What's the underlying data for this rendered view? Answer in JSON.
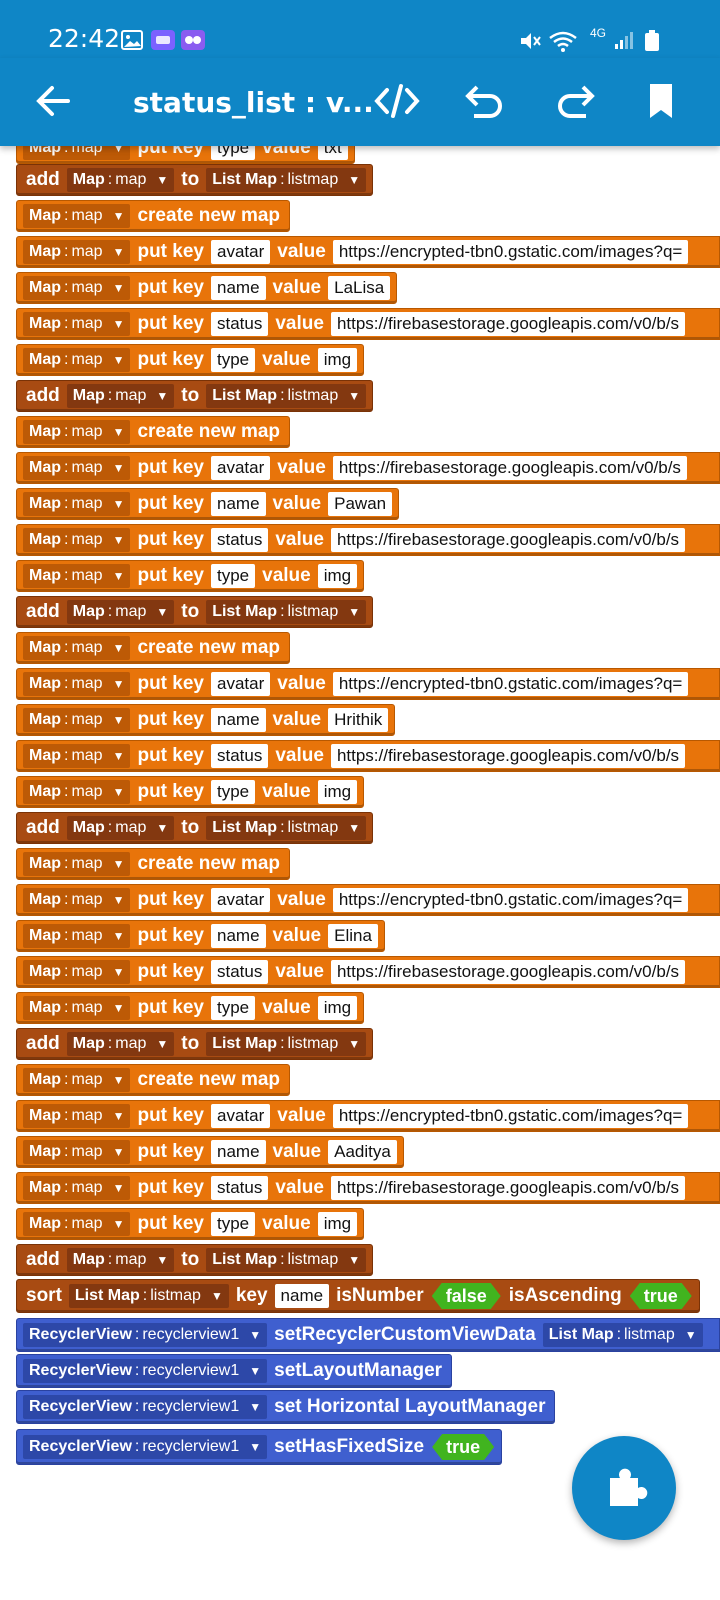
{
  "status_bar": {
    "time": "22:42",
    "network": "4G",
    "icons": [
      "gallery-icon",
      "purple-app-icon",
      "link-app-icon",
      "mute-icon",
      "wifi-icon",
      "signal-icon",
      "battery-icon"
    ]
  },
  "app_bar": {
    "title": "status_list : v...",
    "icons": [
      "back-arrow-icon",
      "code-icon",
      "undo-icon",
      "redo-icon",
      "bookmark-icon"
    ]
  },
  "labels": {
    "put_key": "put key",
    "value": "value",
    "create_new_map": "create new map",
    "add": "add",
    "to": "to",
    "map_type": "Map",
    "map_var": "map",
    "listmap_type": "List Map",
    "listmap_var": "listmap",
    "sort": "sort",
    "key": "key",
    "is_number": "isNumber",
    "is_ascending": "isAscending",
    "recycler_type": "RecyclerView",
    "recycler_var": "recyclerview1"
  },
  "blocks": {
    "partial_top": {
      "key": "type",
      "value": "txt"
    },
    "map_lalisa": {
      "avatar_key": "avatar",
      "avatar": "https://encrypted-tbn0.gstatic.com/images?q=",
      "name_key": "name",
      "name": "LaLisa",
      "status_key": "status",
      "status": "https://firebasestorage.googleapis.com/v0/b/s",
      "type_key": "type",
      "type": "img"
    },
    "map_pawan": {
      "avatar_key": "avatar",
      "avatar": "https://firebasestorage.googleapis.com/v0/b/s",
      "name_key": "name",
      "name": "Pawan",
      "status_key": "status",
      "status": "https://firebasestorage.googleapis.com/v0/b/s",
      "type_key": "type",
      "type": "img"
    },
    "map_hrithik": {
      "avatar_key": "avatar",
      "avatar": "https://encrypted-tbn0.gstatic.com/images?q=",
      "name_key": "name",
      "name": "Hrithik",
      "status_key": "status",
      "status": "https://firebasestorage.googleapis.com/v0/b/s",
      "type_key": "type",
      "type": "img"
    },
    "map_elina": {
      "avatar_key": "avatar",
      "avatar": "https://encrypted-tbn0.gstatic.com/images?q=",
      "name_key": "name",
      "name": "Elina",
      "status_key": "status",
      "status": "https://firebasestorage.googleapis.com/v0/b/s",
      "type_key": "type",
      "type": "img"
    },
    "map_aaditya": {
      "avatar_key": "avatar",
      "avatar": "https://encrypted-tbn0.gstatic.com/images?q=",
      "name_key": "name",
      "name": "Aaditya",
      "status_key": "status",
      "status": "https://firebasestorage.googleapis.com/v0/b/s",
      "type_key": "type",
      "type": "img"
    },
    "sort": {
      "key_value": "name",
      "is_number": "false",
      "is_ascending": "true"
    },
    "recycler": {
      "set_custom_view_data": "setRecyclerCustomViewData",
      "set_layout_manager": "setLayoutManager",
      "set_horizontal": "set Horizontal LayoutManager",
      "set_fixed_size": "setHasFixedSize",
      "fixed_size_value": "true"
    }
  },
  "colors": {
    "app_bar": "#0f86c6",
    "map_block": "#e8740a",
    "list_block": "#a84b12",
    "view_block": "#3f5fcf",
    "boolean": "#41b41f"
  },
  "fab": {
    "icon": "puzzle-piece-icon"
  }
}
